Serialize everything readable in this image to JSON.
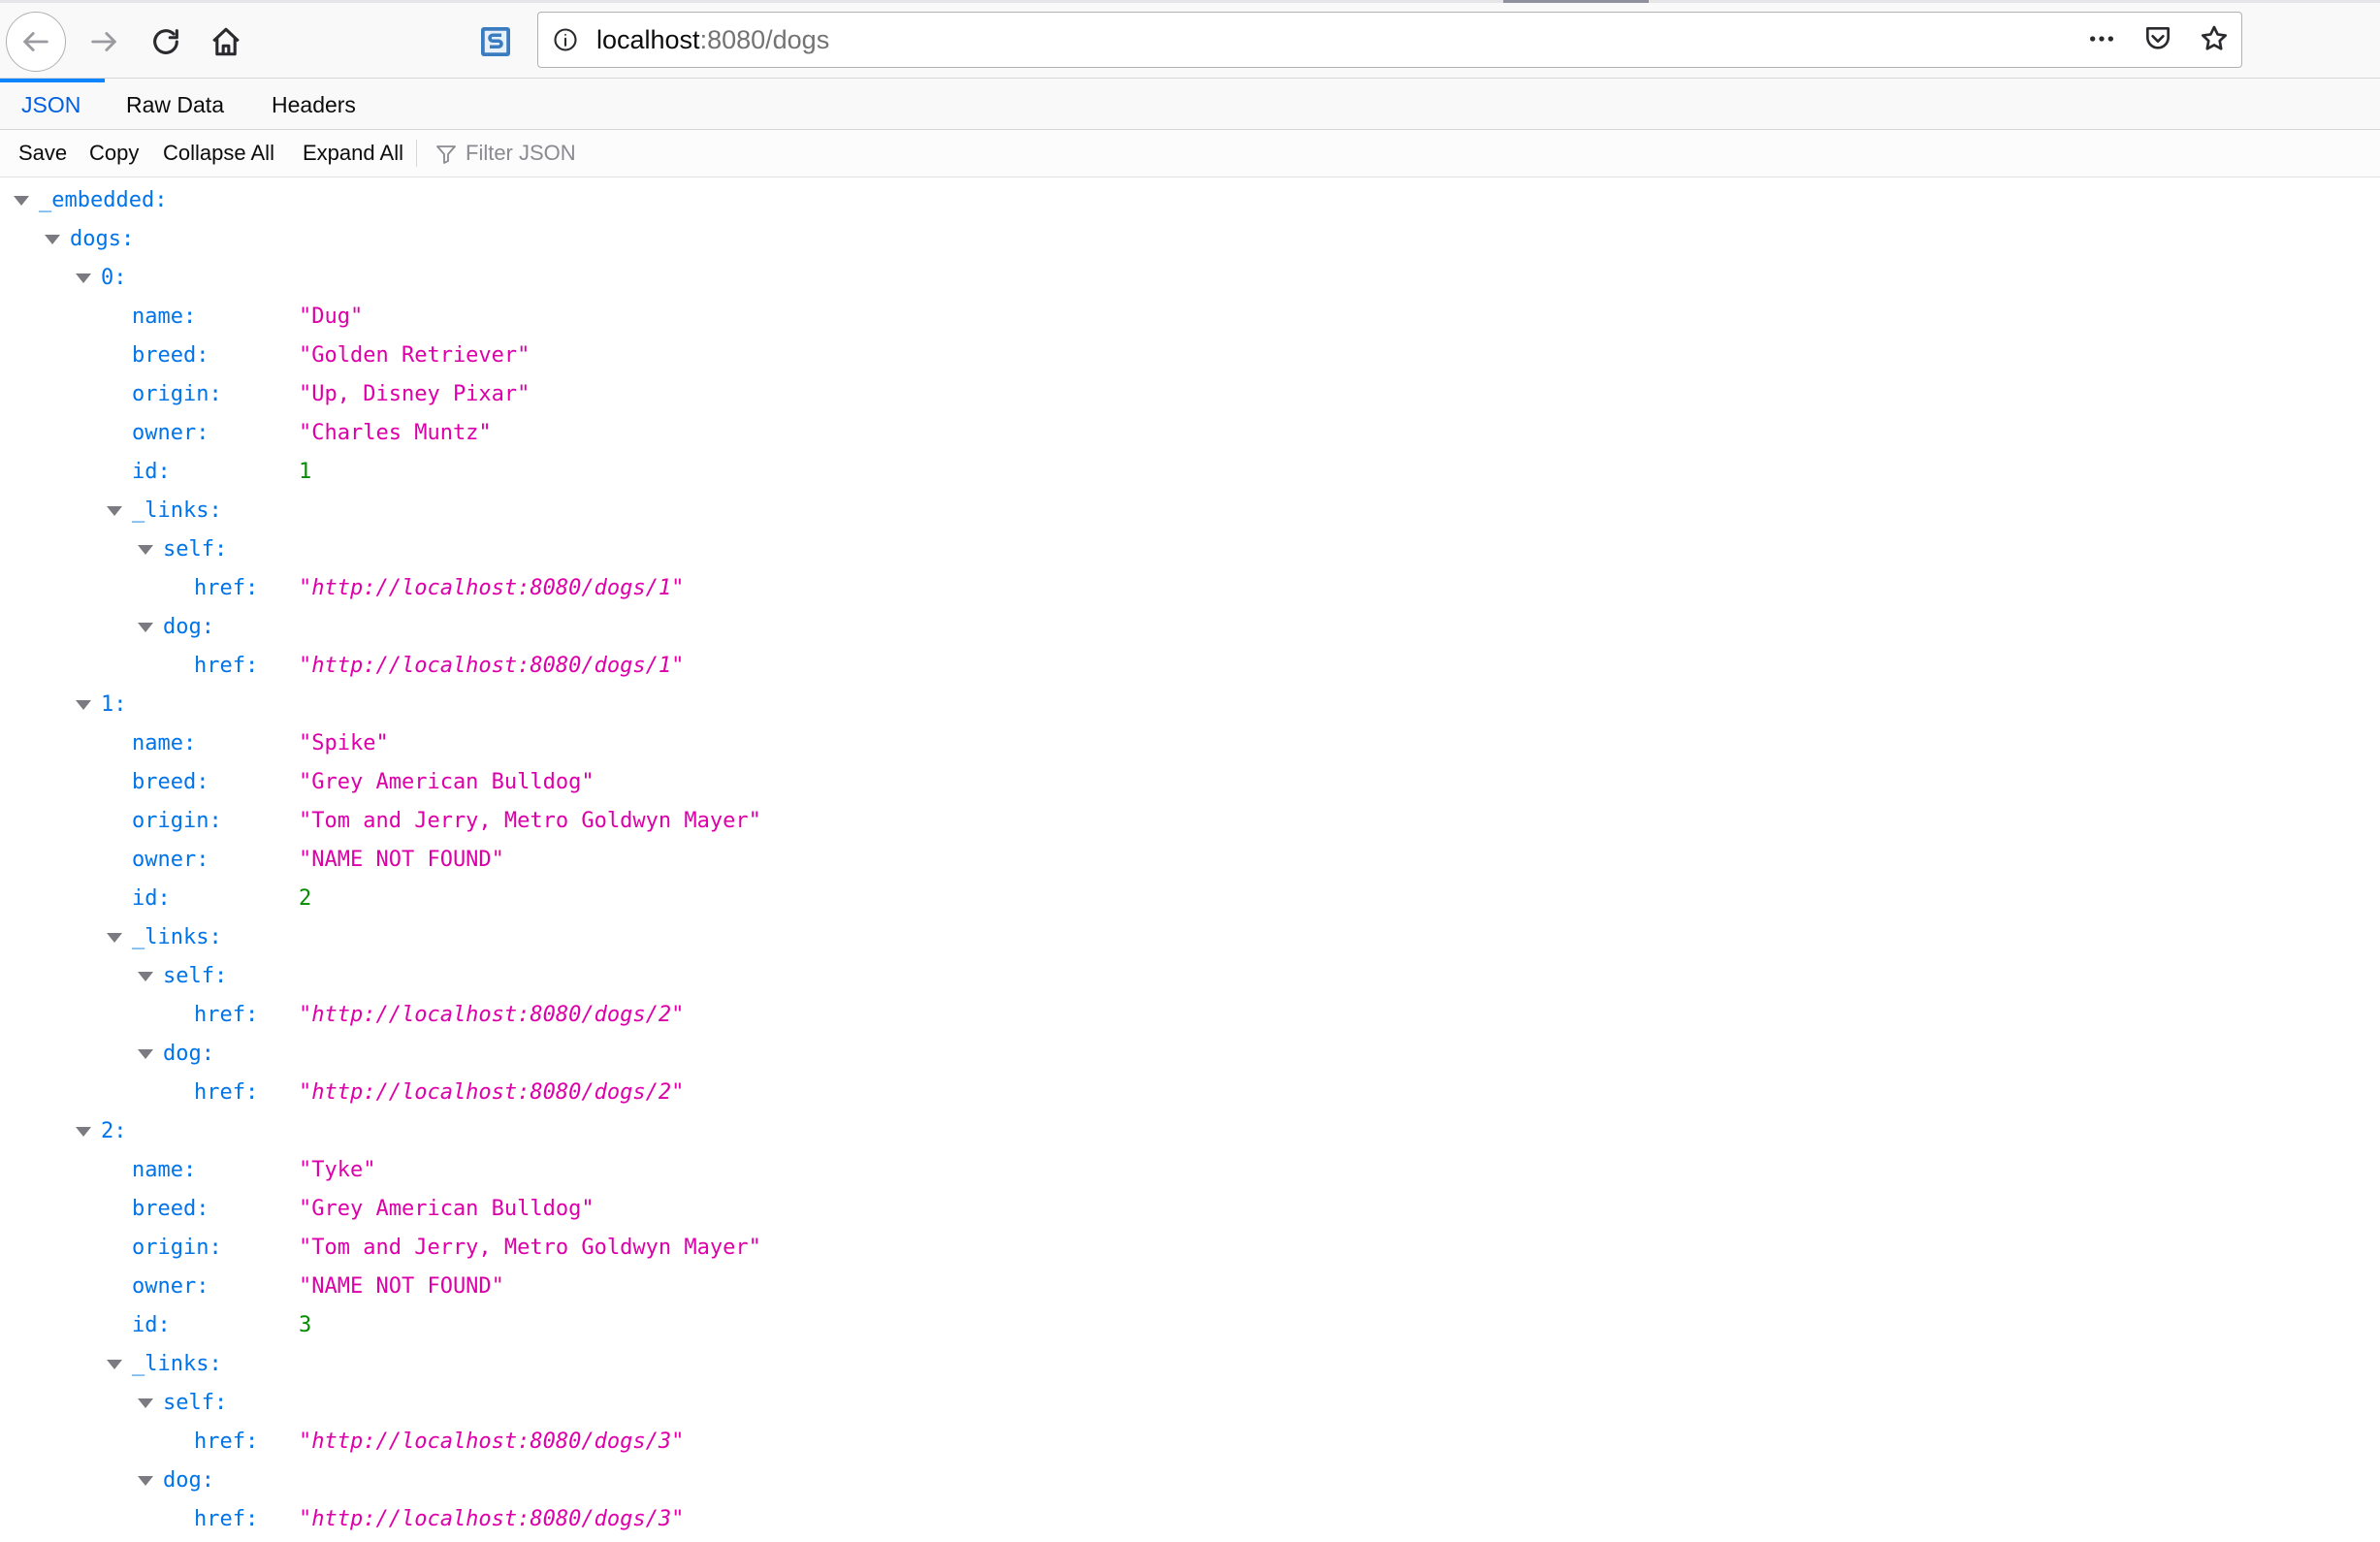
{
  "browser": {
    "url_host": "localhost",
    "url_path": ":8080/dogs",
    "icons": {
      "back": "arrow-left-icon",
      "forward": "arrow-right-icon",
      "reload": "reload-icon",
      "home": "home-icon",
      "extension": "s-extension-icon",
      "site_info": "info-icon",
      "page_actions": "more-dots-icon",
      "pocket": "pocket-icon",
      "bookmark": "star-icon"
    }
  },
  "viewer": {
    "tabs": [
      "JSON",
      "Raw Data",
      "Headers"
    ],
    "selected_tab": "JSON",
    "actions": [
      "Save",
      "Copy",
      "Collapse All",
      "Expand All"
    ],
    "filter_placeholder": "Filter JSON"
  },
  "json": {
    "embedded_key": "_embedded:",
    "dogs_key": "dogs:",
    "dogs": [
      {
        "index": "0:",
        "name": "\"Dug\"",
        "breed": "\"Golden Retriever\"",
        "origin": "\"Up, Disney Pixar\"",
        "owner": "\"Charles Muntz\"",
        "id": "1",
        "self_href": "\"http://localhost:8080/dogs/1\"",
        "dog_href": "\"http://localhost:8080/dogs/1\""
      },
      {
        "index": "1:",
        "name": "\"Spike\"",
        "breed": "\"Grey American Bulldog\"",
        "origin": "\"Tom and Jerry, Metro Goldwyn Mayer\"",
        "owner": "\"NAME NOT FOUND\"",
        "id": "2",
        "self_href": "\"http://localhost:8080/dogs/2\"",
        "dog_href": "\"http://localhost:8080/dogs/2\""
      },
      {
        "index": "2:",
        "name": "\"Tyke\"",
        "breed": "\"Grey American Bulldog\"",
        "origin": "\"Tom and Jerry, Metro Goldwyn Mayer\"",
        "owner": "\"NAME NOT FOUND\"",
        "id": "3",
        "self_href": "\"http://localhost:8080/dogs/3\"",
        "dog_href": "\"http://localhost:8080/dogs/3\""
      }
    ],
    "field_keys": {
      "name": "name:",
      "breed": "breed:",
      "origin": "origin:",
      "owner": "owner:",
      "id": "id:",
      "links": "_links:",
      "self": "self:",
      "dog": "dog:",
      "href": "href:"
    }
  },
  "colors": {
    "key": "#0074e8",
    "string": "#dd00a9",
    "number": "#058b00",
    "selected_tab": "#0060df"
  }
}
